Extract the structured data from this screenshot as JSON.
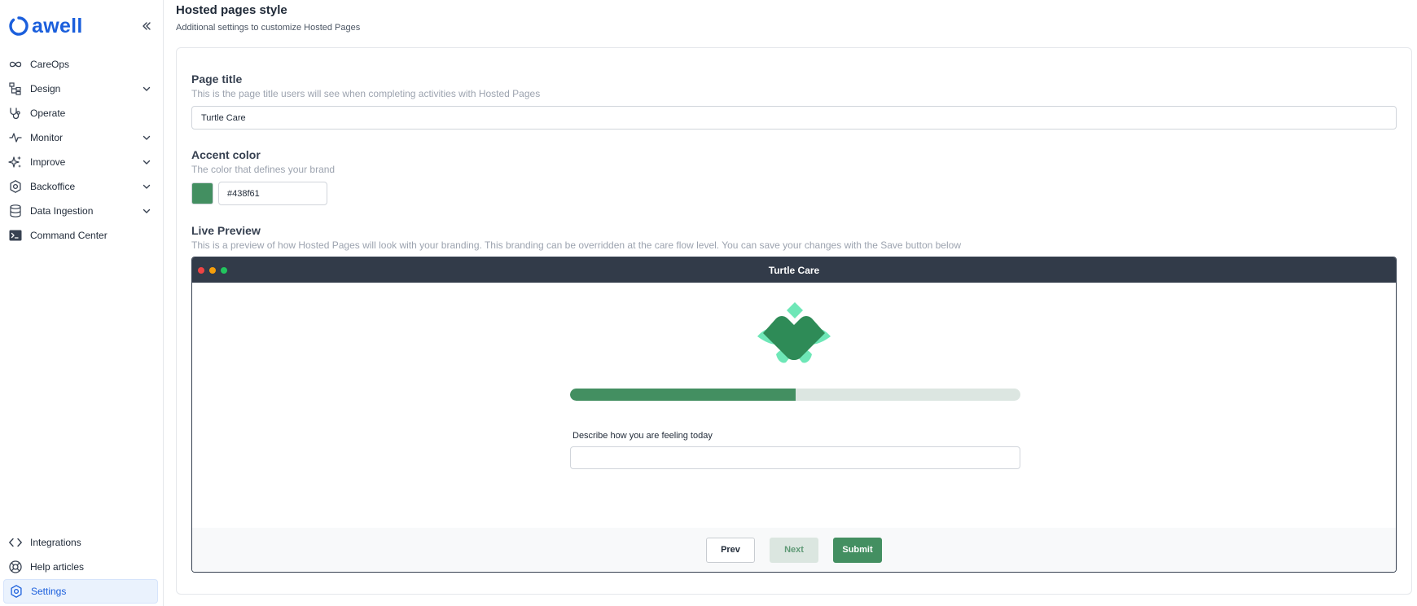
{
  "brand": {
    "name": "awell",
    "color": "#1b5fdc"
  },
  "sidebar": {
    "items": [
      {
        "label": "CareOps",
        "icon": "infinity-icon",
        "expandable": false
      },
      {
        "label": "Design",
        "icon": "hierarchy-icon",
        "expandable": true
      },
      {
        "label": "Operate",
        "icon": "stethoscope-icon",
        "expandable": false
      },
      {
        "label": "Monitor",
        "icon": "pulse-icon",
        "expandable": true
      },
      {
        "label": "Improve",
        "icon": "sparkles-icon",
        "expandable": true
      },
      {
        "label": "Backoffice",
        "icon": "cog-icon",
        "expandable": true
      },
      {
        "label": "Data Ingestion",
        "icon": "database-icon",
        "expandable": true
      },
      {
        "label": "Command Center",
        "icon": "terminal-icon",
        "expandable": false
      }
    ],
    "bottom_items": [
      {
        "label": "Integrations",
        "icon": "code-brackets-icon"
      },
      {
        "label": "Help articles",
        "icon": "lifebuoy-icon"
      },
      {
        "label": "Settings",
        "icon": "settings-icon",
        "active": true
      }
    ]
  },
  "header": {
    "title": "Hosted pages style",
    "subtitle": "Additional settings to customize Hosted Pages"
  },
  "form": {
    "page_title": {
      "label": "Page title",
      "hint": "This is the page title users will see when completing activities with Hosted Pages",
      "value": "Turtle Care"
    },
    "accent_color": {
      "label": "Accent color",
      "hint": "The color that defines your brand",
      "value": "#438f61"
    },
    "live_preview": {
      "label": "Live Preview",
      "hint": "This is a preview of how Hosted Pages will look with your branding. This branding can be overridden at the care flow level. You can save your changes with the Save button below"
    }
  },
  "preview": {
    "window_title": "Turtle Care",
    "dot_colors": [
      "#ef4444",
      "#f59e0b",
      "#22c55e"
    ],
    "progress_fraction": 0.5,
    "question_label": "Describe how you are feeling today",
    "buttons": {
      "prev": "Prev",
      "next": "Next",
      "submit": "Submit"
    }
  }
}
